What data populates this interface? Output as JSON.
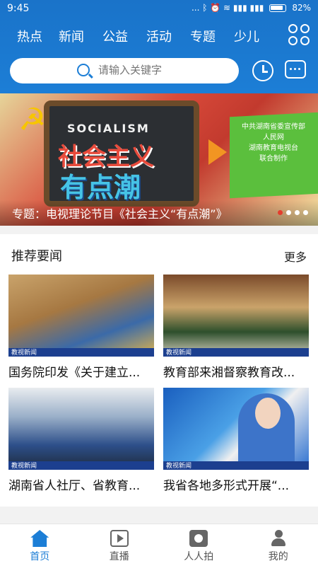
{
  "status_bar": {
    "time": "9:45",
    "icons_text": "... ᛒ ⏰ ≋ ▮▮▮ ▮▮▮",
    "battery": "82%"
  },
  "header": {
    "tabs": [
      "热点",
      "新闻",
      "公益",
      "活动",
      "专题",
      "少儿"
    ],
    "grid_icon": "grid-icon"
  },
  "search": {
    "placeholder": "请输入关键字",
    "icon": "search-icon"
  },
  "actions": {
    "history_icon": "history-icon",
    "message_icon": "message-icon"
  },
  "banner": {
    "board_english": "SOCIALISM",
    "board_title_line1": "社会主义",
    "board_title_line2": "有点潮",
    "side_text": "中共湖南省委宣传部\n人民网\n湖南教育电视台\n联合制作",
    "caption": "专题：电视理论节目《社会主义“有点潮”》",
    "slides": 4,
    "active_slide": 1
  },
  "section": {
    "title": "推荐要闻",
    "more_label": "更多",
    "badge_label": "教视新闻",
    "items": [
      {
        "title": "国务院印发《关于建立..."
      },
      {
        "title": "教育部来湘督察教育改..."
      },
      {
        "title": "湖南省人社厅、省教育..."
      },
      {
        "title": "我省各地多形式开展“..."
      }
    ]
  },
  "bottom_nav": [
    {
      "label": "首页",
      "icon": "home-icon",
      "active": true
    },
    {
      "label": "直播",
      "icon": "live-icon",
      "active": false
    },
    {
      "label": "人人拍",
      "icon": "camera-icon",
      "active": false
    },
    {
      "label": "我的",
      "icon": "user-icon",
      "active": false
    }
  ],
  "colors": {
    "primary": "#1c7ed6",
    "accent_red": "#e43c2e"
  }
}
